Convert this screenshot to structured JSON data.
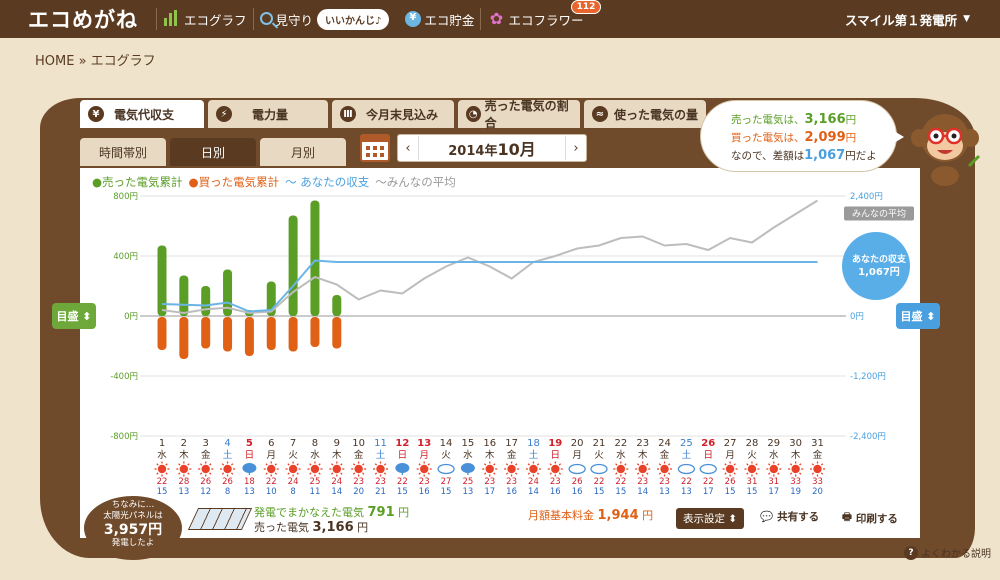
{
  "nav": {
    "brand": "エコめがね",
    "items": [
      {
        "label": "エコグラフ",
        "icon": "graph-icon"
      },
      {
        "label": "見守り",
        "icon": "mimamori-icon"
      },
      {
        "label": "エコ貯金",
        "icon": "coin-icon"
      },
      {
        "label": "エコフラワー",
        "icon": "flower-icon"
      }
    ],
    "status_bubble": "いいかんじ♪",
    "flower_badge": "112",
    "station": "スマイル第１発電所"
  },
  "breadcrumb": "HOME » エコグラフ",
  "tabs": [
    "電気代収支",
    "電力量",
    "今月末見込み",
    "売った電気の割合",
    "使った電気の量"
  ],
  "tab_icons": [
    "¥",
    "⚡",
    "Ⅲ",
    "◔",
    "≈"
  ],
  "subtabs": [
    "時間帯別",
    "日別",
    "月別"
  ],
  "month_label": {
    "year": "2014年",
    "month": "10月"
  },
  "speech": {
    "sold_pre": "売った電気は、",
    "sold_val": "3,166",
    "yen": "円",
    "bought_pre": "買った電気は、",
    "bought_val": "2,099",
    "diff_pre": "なので、差額は",
    "diff_val": "1,067",
    "diff_post": "円だよ"
  },
  "legend": {
    "sold": "●売った電気累計",
    "bought": "●買った電気累計",
    "net": "〜 あなたの収支",
    "avg": "〜みんなの平均"
  },
  "scale_left": "目盛 ⬍",
  "scale_right": "目盛 ⬍",
  "colors": {
    "green": "#5a9e26",
    "orange": "#e06015",
    "blue": "#4aa0df",
    "gray": "#bbbbbb",
    "brown": "#5a3b22"
  },
  "bottom": {
    "solar_title": "ちなみに…",
    "solar_sub": "太陽光パネルは",
    "solar_value": "3,957円",
    "solar_post": "発電したよ",
    "gen_label": "発電でまかなえた電気",
    "gen_value": "791",
    "gen_unit": "円",
    "sold_label": "売った電気",
    "sold_value": "3,166",
    "sold_unit": "円",
    "fee_label": "月額基本料金",
    "fee_value": "1,944",
    "fee_unit": "円",
    "display_btn": "表示設定 ⬍",
    "share_btn": "共有する",
    "print_btn": "印刷する"
  },
  "help": "よくわかる説明",
  "chart_data": {
    "type": "bar",
    "left_axis": {
      "ticks": [
        "800円",
        "400円",
        "0円",
        "-400円",
        "-800円"
      ],
      "values": [
        800,
        400,
        0,
        -400,
        -800
      ]
    },
    "right_axis": {
      "ticks": [
        "2,400円",
        "1,200円",
        "0円",
        "-1,200円",
        "-2,400円"
      ],
      "values": [
        2400,
        1200,
        0,
        -1200,
        -2400
      ]
    },
    "days": [
      "1",
      "2",
      "3",
      "4",
      "5",
      "6",
      "7",
      "8",
      "9",
      "10",
      "11",
      "12",
      "13",
      "14",
      "15",
      "16",
      "17",
      "18",
      "19",
      "20",
      "21",
      "22",
      "23",
      "24",
      "25",
      "26",
      "27",
      "28",
      "29",
      "30",
      "31"
    ],
    "weekdays": [
      "水",
      "木",
      "金",
      "土",
      "日",
      "月",
      "火",
      "水",
      "木",
      "金",
      "土",
      "日",
      "月",
      "火",
      "水",
      "木",
      "金",
      "土",
      "日",
      "月",
      "火",
      "水",
      "木",
      "金",
      "土",
      "日",
      "月",
      "火",
      "水",
      "木",
      "金"
    ],
    "weather": [
      "sun",
      "sun",
      "sun",
      "sun",
      "rain",
      "sun",
      "sun",
      "sun",
      "sun",
      "sun",
      "sun",
      "rain",
      "sun",
      "cloud",
      "rain",
      "sun",
      "sun",
      "sun",
      "sun",
      "cloud",
      "cloud",
      "sun",
      "sun",
      "sun",
      "cloud",
      "cloud",
      "sun",
      "sun",
      "sun",
      "sun",
      "sun"
    ],
    "temp_high": [
      "22",
      "28",
      "26",
      "26",
      "18",
      "22",
      "24",
      "25",
      "24",
      "23",
      "23",
      "22",
      "23",
      "27",
      "25",
      "23",
      "23",
      "24",
      "23",
      "26",
      "22",
      "22",
      "23",
      "23",
      "22",
      "22",
      "26",
      "31",
      "31",
      "33",
      "33"
    ],
    "temp_low": [
      "15",
      "13",
      "12",
      "8",
      "13",
      "10",
      "8",
      "11",
      "14",
      "20",
      "21",
      "15",
      "16",
      "15",
      "13",
      "17",
      "16",
      "14",
      "16",
      "16",
      "15",
      "15",
      "14",
      "13",
      "13",
      "17",
      "15",
      "15",
      "17",
      "19",
      "20"
    ],
    "series": [
      {
        "name": "売った電気累計",
        "values": [
          470,
          270,
          200,
          310,
          40,
          230,
          670,
          770,
          140
        ]
      },
      {
        "name": "買った電気累計",
        "values": [
          -220,
          -280,
          -210,
          -230,
          -260,
          -220,
          -230,
          -200,
          -210
        ]
      },
      {
        "name": "あなたの収支",
        "values": [
          80,
          75,
          70,
          90,
          30,
          40,
          200,
          370,
          360,
          360,
          360,
          360,
          360,
          360,
          360,
          360,
          360,
          360,
          360,
          360,
          360,
          360,
          360,
          360,
          360,
          360,
          360,
          360,
          360,
          360,
          360
        ]
      },
      {
        "name": "みんなの平均",
        "values": [
          40,
          20,
          45,
          55,
          20,
          30,
          160,
          260,
          210,
          110,
          170,
          150,
          250,
          330,
          390,
          330,
          250,
          360,
          400,
          450,
          470,
          520,
          530,
          470,
          480,
          440,
          520,
          490,
          590,
          680,
          770
        ]
      }
    ],
    "avg_tag": "みんなの平均",
    "net_tag_label": "あなたの収支",
    "net_tag_value": "1,067円",
    "ylim": [
      -800,
      800
    ]
  }
}
